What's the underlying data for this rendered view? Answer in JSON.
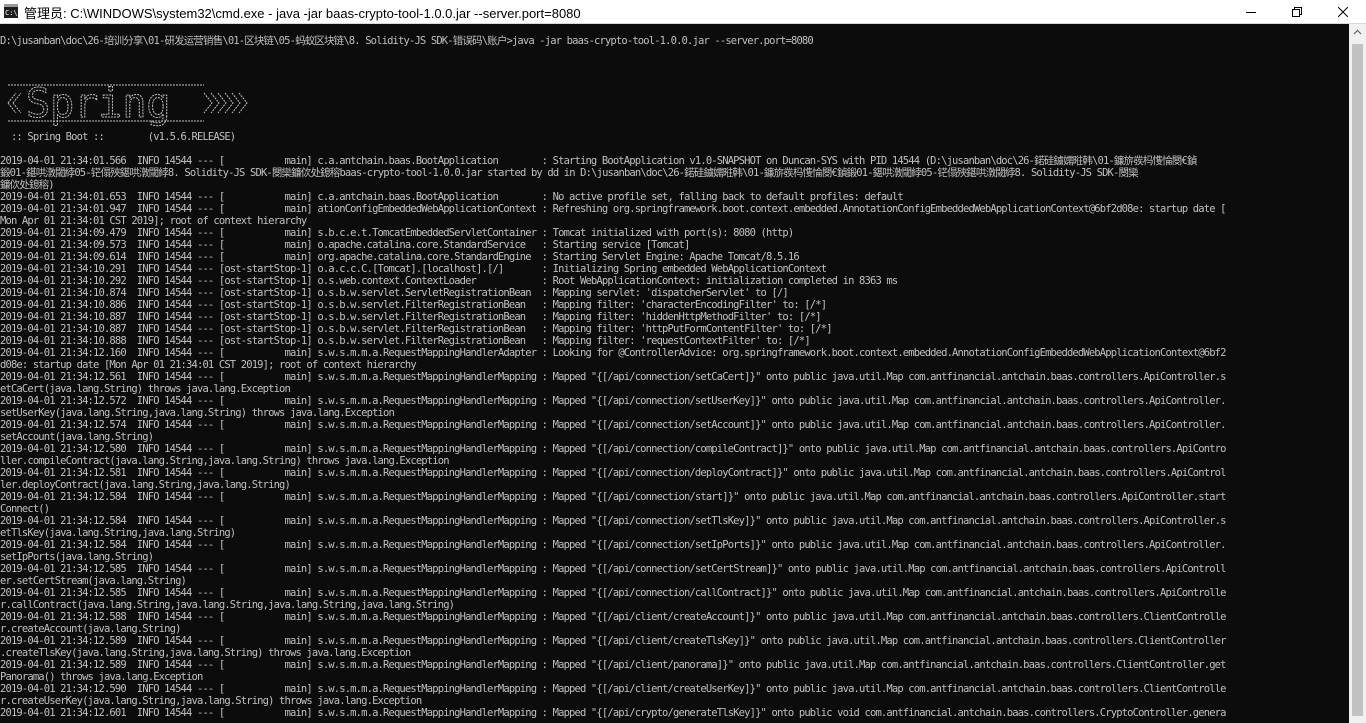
{
  "window": {
    "title": "管理员: C:\\WINDOWS\\system32\\cmd.exe - java  -jar baas-crypto-tool-1.0.0.jar --server.port=8080"
  },
  "console": {
    "command": "D:\\jusanban\\doc\\26-培训分享\\01-研发运营销售\\01-区块链\\05-蚂蚁区块链\\8. Solidity-JS SDK-错误码\\账户>java -jar baas-crypto-tool-1.0.0.jar --server.port=8080",
    "banner_logo_text": "Spring",
    "spring_boot_version": "  :: Spring Boot ::        (v1.5.6.RELEASE)",
    "lines": [
      "2019-04-01 21:34:01.566  INFO 14544 --- [           main] c.a.antchain.baas.BootApplication        : Starting BootApplication v1.0-SNAPSHOT on Duncan-SYS with PID 14544 (D:\\jusanban\\doc\\26-鍩硅鐪嬬暀韩\\01-鐮旂彂杩愯惀閿€鍞",
      "鍛01-鍖哄潡閾綍05-铓傝殎鍖哄潡閾綍8. Solidity-JS SDK-閿欒鐮佽处鎴穃baas-crypto-tool-1.0.0.jar started by dd in D:\\jusanban\\doc\\26-鍩硅鐪嬬暀韩\\01-鐮旂彂杩愯惀閿€鍞鍛01-鍖哄潡閾綍05-铓傝殎鍖哄潡閾綍8. Solidity-JS SDK-閿欒",
      "鐮佽处鎴穃)",
      "2019-04-01 21:34:01.653  INFO 14544 --- [           main] c.a.antchain.baas.BootApplication        : No active profile set, falling back to default profiles: default",
      "2019-04-01 21:34:01.947  INFO 14544 --- [           main] ationConfigEmbeddedWebApplicationContext : Refreshing org.springframework.boot.context.embedded.AnnotationConfigEmbeddedWebApplicationContext@6bf2d08e: startup date [",
      "Mon Apr 01 21:34:01 CST 2019]; root of context hierarchy",
      "2019-04-01 21:34:09.479  INFO 14544 --- [           main] s.b.c.e.t.TomcatEmbeddedServletContainer : Tomcat initialized with port(s): 8080 (http)",
      "2019-04-01 21:34:09.573  INFO 14544 --- [           main] o.apache.catalina.core.StandardService   : Starting service [Tomcat]",
      "2019-04-01 21:34:09.614  INFO 14544 --- [           main] org.apache.catalina.core.StandardEngine  : Starting Servlet Engine: Apache Tomcat/8.5.16",
      "2019-04-01 21:34:10.291  INFO 14544 --- [ost-startStop-1] o.a.c.c.C.[Tomcat].[localhost].[/]       : Initializing Spring embedded WebApplicationContext",
      "2019-04-01 21:34:10.292  INFO 14544 --- [ost-startStop-1] o.s.web.context.ContextLoader            : Root WebApplicationContext: initialization completed in 8363 ms",
      "2019-04-01 21:34:10.874  INFO 14544 --- [ost-startStop-1] o.s.b.w.servlet.ServletRegistrationBean  : Mapping servlet: 'dispatcherServlet' to [/]",
      "2019-04-01 21:34:10.886  INFO 14544 --- [ost-startStop-1] o.s.b.w.servlet.FilterRegistrationBean   : Mapping filter: 'characterEncodingFilter' to: [/*]",
      "2019-04-01 21:34:10.887  INFO 14544 --- [ost-startStop-1] o.s.b.w.servlet.FilterRegistrationBean   : Mapping filter: 'hiddenHttpMethodFilter' to: [/*]",
      "2019-04-01 21:34:10.887  INFO 14544 --- [ost-startStop-1] o.s.b.w.servlet.FilterRegistrationBean   : Mapping filter: 'httpPutFormContentFilter' to: [/*]",
      "2019-04-01 21:34:10.888  INFO 14544 --- [ost-startStop-1] o.s.b.w.servlet.FilterRegistrationBean   : Mapping filter: 'requestContextFilter' to: [/*]",
      "2019-04-01 21:34:12.160  INFO 14544 --- [           main] s.w.s.m.m.a.RequestMappingHandlerAdapter : Looking for @ControllerAdvice: org.springframework.boot.context.embedded.AnnotationConfigEmbeddedWebApplicationContext@6bf2",
      "d08e: startup date [Mon Apr 01 21:34:01 CST 2019]; root of context hierarchy",
      "2019-04-01 21:34:12.561  INFO 14544 --- [           main] s.w.s.m.m.a.RequestMappingHandlerMapping : Mapped \"{[/api/connection/setCaCert]}\" onto public java.util.Map com.antfinancial.antchain.baas.controllers.ApiController.s",
      "etCaCert(java.lang.String) throws java.lang.Exception",
      "2019-04-01 21:34:12.572  INFO 14544 --- [           main] s.w.s.m.m.a.RequestMappingHandlerMapping : Mapped \"{[/api/connection/setUserKey]}\" onto public java.util.Map com.antfinancial.antchain.baas.controllers.ApiController.",
      "setUserKey(java.lang.String,java.lang.String) throws java.lang.Exception",
      "2019-04-01 21:34:12.574  INFO 14544 --- [           main] s.w.s.m.m.a.RequestMappingHandlerMapping : Mapped \"{[/api/connection/setAccount]}\" onto public java.util.Map com.antfinancial.antchain.baas.controllers.ApiController.",
      "setAccount(java.lang.String)",
      "2019-04-01 21:34:12.580  INFO 14544 --- [           main] s.w.s.m.m.a.RequestMappingHandlerMapping : Mapped \"{[/api/connection/compileContract]}\" onto public java.util.Map com.antfinancial.antchain.baas.controllers.ApiContro",
      "ller.compileContract(java.lang.String,java.lang.String) throws java.lang.Exception",
      "2019-04-01 21:34:12.581  INFO 14544 --- [           main] s.w.s.m.m.a.RequestMappingHandlerMapping : Mapped \"{[/api/connection/deployContract]}\" onto public java.util.Map com.antfinancial.antchain.baas.controllers.ApiControl",
      "ler.deployContract(java.lang.String,java.lang.String)",
      "2019-04-01 21:34:12.584  INFO 14544 --- [           main] s.w.s.m.m.a.RequestMappingHandlerMapping : Mapped \"{[/api/connection/start]}\" onto public java.util.Map com.antfinancial.antchain.baas.controllers.ApiController.start",
      "Connect()",
      "2019-04-01 21:34:12.584  INFO 14544 --- [           main] s.w.s.m.m.a.RequestMappingHandlerMapping : Mapped \"{[/api/connection/setTlsKey]}\" onto public java.util.Map com.antfinancial.antchain.baas.controllers.ApiController.s",
      "etTlsKey(java.lang.String,java.lang.String)",
      "2019-04-01 21:34:12.584  INFO 14544 --- [           main] s.w.s.m.m.a.RequestMappingHandlerMapping : Mapped \"{[/api/connection/setIpPorts]}\" onto public java.util.Map com.antfinancial.antchain.baas.controllers.ApiController.",
      "setIpPorts(java.lang.String)",
      "2019-04-01 21:34:12.585  INFO 14544 --- [           main] s.w.s.m.m.a.RequestMappingHandlerMapping : Mapped \"{[/api/connection/setCertStream]}\" onto public java.util.Map com.antfinancial.antchain.baas.controllers.ApiControll",
      "er.setCertStream(java.lang.String)",
      "2019-04-01 21:34:12.585  INFO 14544 --- [           main] s.w.s.m.m.a.RequestMappingHandlerMapping : Mapped \"{[/api/connection/callContract]}\" onto public java.util.Map com.antfinancial.antchain.baas.controllers.ApiControlle",
      "r.callContract(java.lang.String,java.lang.String,java.lang.String,java.lang.String)",
      "2019-04-01 21:34:12.588  INFO 14544 --- [           main] s.w.s.m.m.a.RequestMappingHandlerMapping : Mapped \"{[/api/client/createAccount]}\" onto public java.util.Map com.antfinancial.antchain.baas.controllers.ClientControlle",
      "r.createAccount(java.lang.String)",
      "2019-04-01 21:34:12.589  INFO 14544 --- [           main] s.w.s.m.m.a.RequestMappingHandlerMapping : Mapped \"{[/api/client/createTlsKey]}\" onto public java.util.Map com.antfinancial.antchain.baas.controllers.ClientController",
      ".createTlsKey(java.lang.String,java.lang.String) throws java.lang.Exception",
      "2019-04-01 21:34:12.589  INFO 14544 --- [           main] s.w.s.m.m.a.RequestMappingHandlerMapping : Mapped \"{[/api/client/panorama]}\" onto public java.util.Map com.antfinancial.antchain.baas.controllers.ClientController.get",
      "Panorama() throws java.lang.Exception",
      "2019-04-01 21:34:12.590  INFO 14544 --- [           main] s.w.s.m.m.a.RequestMappingHandlerMapping : Mapped \"{[/api/client/createUserKey]}\" onto public java.util.Map com.antfinancial.antchain.baas.controllers.ClientControlle",
      "r.createUserKey(java.lang.String,java.lang.String) throws java.lang.Exception",
      "2019-04-01 21:34:12.601  INFO 14544 --- [           main] s.w.s.m.m.a.RequestMappingHandlerMapping : Mapped \"{[/api/crypto/generateTlsKey]}\" onto public void com.antfinancial.antchain.baas.controllers.CryptoController.genera"
    ]
  }
}
